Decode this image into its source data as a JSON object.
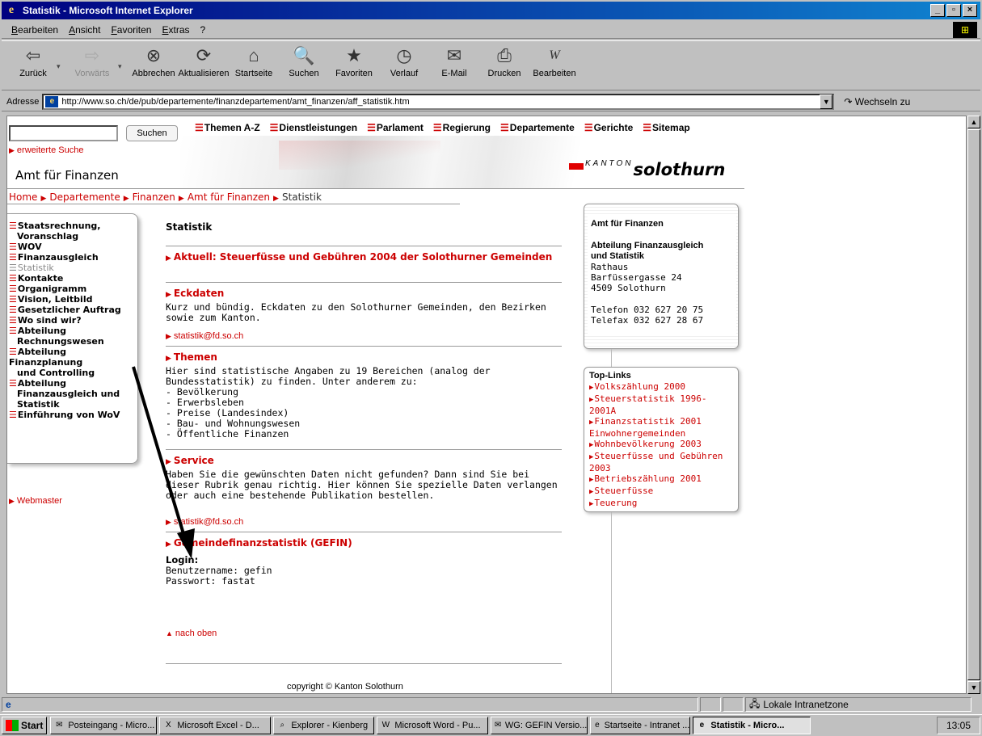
{
  "window": {
    "title": "Statistik - Microsoft Internet Explorer"
  },
  "menu": [
    "Bearbeiten",
    "Ansicht",
    "Favoriten",
    "Extras",
    "?"
  ],
  "toolbar": [
    {
      "label": "Zurück",
      "icon": "back-arrow-icon",
      "glyph": "⇦",
      "disabled": false
    },
    {
      "label": "Vorwärts",
      "icon": "forward-arrow-icon",
      "glyph": "⇨",
      "disabled": true
    },
    {
      "label": "Abbrechen",
      "icon": "stop-icon",
      "glyph": "⊗",
      "disabled": false
    },
    {
      "label": "Aktualisieren",
      "icon": "refresh-icon",
      "glyph": "⟳",
      "disabled": false
    },
    {
      "label": "Startseite",
      "icon": "home-icon",
      "glyph": "⌂",
      "disabled": false
    },
    {
      "label": "Suchen",
      "icon": "search-icon",
      "glyph": "🔍",
      "disabled": false
    },
    {
      "label": "Favoriten",
      "icon": "favorites-icon",
      "glyph": "★",
      "disabled": false
    },
    {
      "label": "Verlauf",
      "icon": "history-icon",
      "glyph": "◷",
      "disabled": false
    },
    {
      "label": "E-Mail",
      "icon": "mail-icon",
      "glyph": "✉",
      "disabled": false
    },
    {
      "label": "Drucken",
      "icon": "print-icon",
      "glyph": "⎙",
      "disabled": false
    },
    {
      "label": "Bearbeiten",
      "icon": "edit-icon",
      "glyph": "W",
      "disabled": false
    }
  ],
  "address": {
    "label": "Adresse",
    "url": "http://www.so.ch/de/pub/departemente/finanzdepartement/amt_finanzen/aff_statistik.htm",
    "go": "Wechseln zu"
  },
  "page": {
    "search_button": "Suchen",
    "advanced_search": "erweiterte Suche",
    "topnav": [
      "Themen A-Z",
      "Dienstleistungen",
      "Parlament",
      "Regierung",
      "Departemente",
      "Gerichte",
      "Sitemap"
    ],
    "amt_title": "Amt für Finanzen",
    "logo_kanton": "KANTON",
    "logo_name": "solothurn",
    "breadcrumb": [
      "Home",
      "Departemente",
      "Finanzen",
      "Amt für Finanzen"
    ],
    "breadcrumb_current": "Statistik",
    "leftnav": [
      {
        "label": "Staatsrechnung,",
        "cont": "Voranschlag",
        "current": false
      },
      {
        "label": "WOV",
        "current": false
      },
      {
        "label": "Finanzausgleich",
        "current": false
      },
      {
        "label": "Statistik",
        "current": true
      },
      {
        "label": "Kontakte",
        "current": false
      },
      {
        "label": "Organigramm",
        "current": false
      },
      {
        "label": "Vision, Leitbild",
        "current": false
      },
      {
        "label": "Gesetzlicher Auftrag",
        "current": false
      },
      {
        "label": "Wo sind wir?",
        "current": false
      },
      {
        "label": "Abteilung",
        "cont": "Rechnungswesen",
        "current": false
      },
      {
        "label": "Abteilung Finanzplanung",
        "cont": "und Controlling",
        "current": false
      },
      {
        "label": "Abteilung",
        "cont": "Finanzausgleich und",
        "cont2": "Statistik",
        "current": false
      },
      {
        "label": "Einführung von WoV",
        "current": false
      }
    ],
    "webmaster": "Webmaster",
    "content": {
      "title": "Statistik",
      "aktuell": "Aktuell: Steuerfüsse und Gebühren 2004 der Solothurner Gemeinden",
      "eckdaten_head": "Eckdaten",
      "eckdaten_text": "Kurz und bündig. Eckdaten zu den Solothurner Gemeinden, den Bezirken sowie zum Kanton.",
      "email1": "statistik@fd.so.ch",
      "themen_head": "Themen",
      "themen_text": "Hier sind statistische Angaben zu 19 Bereichen (analog der Bundesstatistik) zu finden. Unter anderem zu:",
      "themen_list": [
        "- Bevölkerung",
        "- Erwerbsleben",
        "- Preise (Landesindex)",
        "- Bau- und Wohnungswesen",
        "- Öffentliche Finanzen"
      ],
      "service_head": "Service",
      "service_text": "Haben Sie die gewünschten Daten nicht gefunden? Dann sind Sie bei dieser Rubrik genau richtig. Hier können Sie spezielle Daten verlangen oder auch eine bestehende Publikation bestellen.",
      "email2": "statistik@fd.so.ch",
      "gefin_head": "Gemeindefinanzstatistik (GEFIN)",
      "login_label": "Login:",
      "username": "Benutzername: gefin",
      "password": "Passwort: fastat",
      "top_link": "nach oben",
      "copyright": "copyright © Kanton Solothurn"
    },
    "contact": {
      "title": "Amt für Finanzen",
      "dept1": "Abteilung Finanzausgleich",
      "dept2": "und Statistik",
      "lines": [
        "Rathaus",
        "Barfüssergasse 24",
        "4509 Solothurn"
      ],
      "phone": "Telefon 032 627 20 75",
      "fax": "Telefax 032 627 28 67"
    },
    "toplinks_title": "Top-Links",
    "toplinks": [
      "Volkszählung 2000",
      "Steuerstatistik 1996-2001A",
      "Finanzstatistik 2001",
      "Einwohnergemeinden",
      "Wohnbevölkerung 2003",
      "Steuerfüsse und Gebühren",
      "2003",
      "Betriebszählung 2001",
      "Steuerfüsse",
      "Teuerung"
    ]
  },
  "status": {
    "zone": "Lokale Intranetzone"
  },
  "taskbar": {
    "start": "Start",
    "tasks": [
      "Posteingang - Micro...",
      "Microsoft Excel - D...",
      "Explorer - Kienberg",
      "Microsoft Word - Pu...",
      "WG: GEFIN Versio...",
      "Startseite - Intranet ...",
      "Statistik - Micro..."
    ],
    "clock": "13:05"
  },
  "colors": {
    "accent_red": "#cc0000",
    "title_blue": "#000080"
  }
}
